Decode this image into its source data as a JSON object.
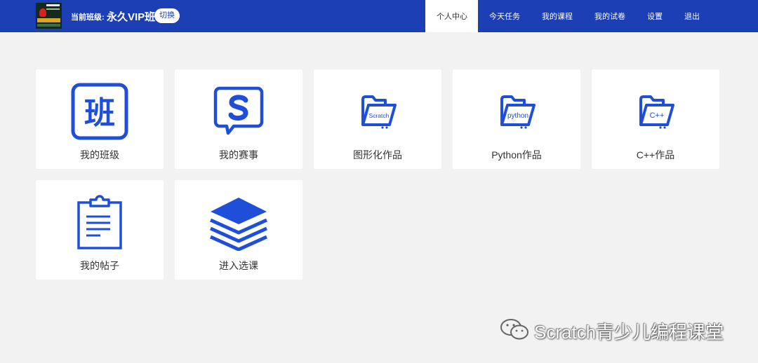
{
  "header": {
    "class_label": "当前班级:",
    "class_name": "永久VIP班",
    "switch_label": "切换",
    "logo_icon": "scratch-course-logo-icon"
  },
  "nav": {
    "items": [
      {
        "label": "个人中心",
        "active": true
      },
      {
        "label": "今天任务"
      },
      {
        "label": "我的课程"
      },
      {
        "label": "我的试卷"
      },
      {
        "label": "设置"
      },
      {
        "label": "退出"
      }
    ]
  },
  "cards": [
    {
      "label": "我的班级",
      "icon": "class-ban-icon"
    },
    {
      "label": "我的赛事",
      "icon": "competition-s-icon"
    },
    {
      "label": "图形化作品",
      "icon": "folder-scratch-icon",
      "icon_text": "Scratch"
    },
    {
      "label": "Python作品",
      "icon": "folder-python-icon",
      "icon_text": "python"
    },
    {
      "label": "C++作品",
      "icon": "folder-cpp-icon",
      "icon_text": "C++"
    },
    {
      "label": "我的帖子",
      "icon": "clipboard-post-icon"
    },
    {
      "label": "进入选课",
      "icon": "layers-icon"
    }
  ],
  "watermark": {
    "text": "Scratch青少儿编程课堂",
    "icon": "wechat-icon"
  },
  "colors": {
    "brand": "#1c3fb6",
    "icon_blue": "#1f4fd8",
    "background": "#f2f2f2"
  }
}
